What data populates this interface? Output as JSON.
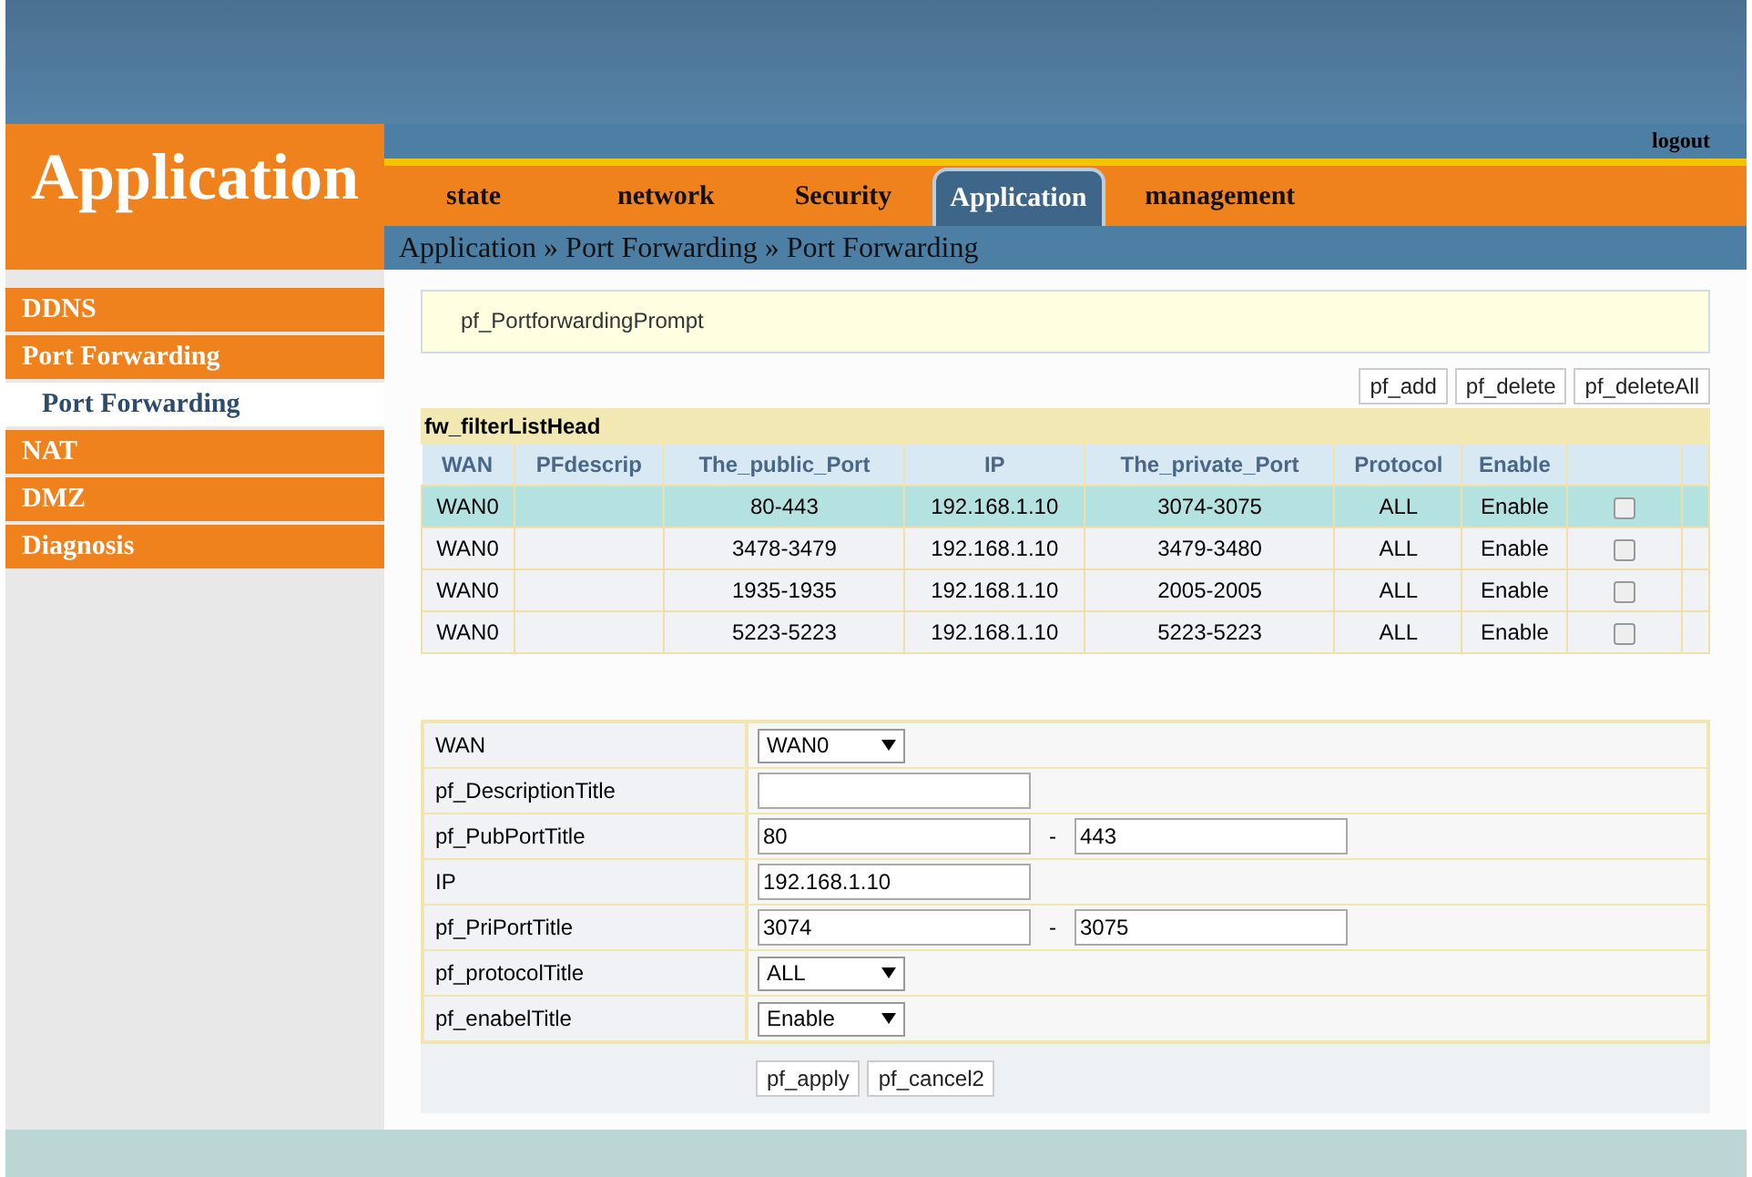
{
  "header": {
    "logo": "Application",
    "logout": "logout"
  },
  "tabs": [
    {
      "label": "state",
      "selected": false
    },
    {
      "label": "network",
      "selected": false
    },
    {
      "label": "Security",
      "selected": false
    },
    {
      "label": "Application",
      "selected": true
    },
    {
      "label": "management",
      "selected": false
    }
  ],
  "breadcrumb": "Application » Port Forwarding » Port Forwarding",
  "sidebar": {
    "items": [
      {
        "label": "DDNS",
        "selected": false
      },
      {
        "label": "Port Forwarding",
        "selected": false,
        "children": [
          {
            "label": "Port Forwarding",
            "selected": true
          }
        ]
      },
      {
        "label": "NAT",
        "selected": false
      },
      {
        "label": "DMZ",
        "selected": false
      },
      {
        "label": "Diagnosis",
        "selected": false
      }
    ]
  },
  "prompt": "pf_PortforwardingPrompt",
  "list_buttons": [
    "pf_add",
    "pf_delete",
    "pf_deleteAll"
  ],
  "table": {
    "title": "fw_filterListHead",
    "columns": [
      "WAN",
      "PFdescrip",
      "The_public_Port",
      "IP",
      "The_private_Port",
      "Protocol",
      "Enable"
    ],
    "rows": [
      {
        "cells": [
          "WAN0",
          "",
          "80-443",
          "192.168.1.10",
          "3074-3075",
          "ALL",
          "Enable"
        ],
        "selected": true,
        "checked": false
      },
      {
        "cells": [
          "WAN0",
          "",
          "3478-3479",
          "192.168.1.10",
          "3479-3480",
          "ALL",
          "Enable"
        ],
        "selected": false,
        "checked": false
      },
      {
        "cells": [
          "WAN0",
          "",
          "1935-1935",
          "192.168.1.10",
          "2005-2005",
          "ALL",
          "Enable"
        ],
        "selected": false,
        "checked": false
      },
      {
        "cells": [
          "WAN0",
          "",
          "5223-5223",
          "192.168.1.10",
          "5223-5223",
          "ALL",
          "Enable"
        ],
        "selected": false,
        "checked": false
      }
    ]
  },
  "form": {
    "rows": [
      {
        "kind": "select",
        "label": "WAN",
        "value": "WAN0"
      },
      {
        "kind": "text",
        "label": "pf_DescriptionTitle"
      },
      {
        "kind": "range",
        "label": "pf_PubPortTitle",
        "value": "80",
        "separator": "-",
        "value2": "443"
      },
      {
        "kind": "text",
        "label": "IP",
        "value": "192.168.1.10"
      },
      {
        "kind": "range",
        "label": "pf_PriPortTitle",
        "value": "3074",
        "separator": "-",
        "value2": "3075"
      },
      {
        "kind": "select",
        "label": "pf_protocolTitle",
        "value": "ALL"
      },
      {
        "kind": "select",
        "label": "pf_enabelTitle",
        "value": "Enable"
      }
    ],
    "buttons": [
      "pf_apply",
      "pf_cancel2"
    ]
  }
}
